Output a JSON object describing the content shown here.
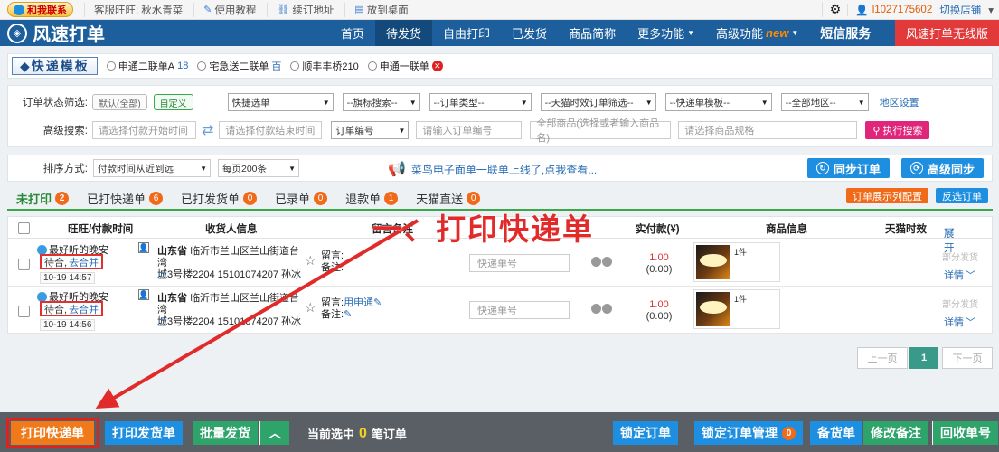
{
  "topbar": {
    "contact_label": "和我联系",
    "service_label": "客服旺旺:",
    "service_name": "秋水青菜",
    "tutorial": "使用教程",
    "renew": "续订地址",
    "desktop": "放到桌面",
    "username": "l1027175602",
    "switch_store": "切换店铺"
  },
  "nav": {
    "app_title": "风速打单",
    "items": [
      "首页",
      "待发货",
      "自由打印",
      "已发货",
      "商品简称",
      "更多功能",
      "高级功能"
    ],
    "new_tag": "new",
    "sms": "短信服务",
    "unlimited": "风速打单无线版"
  },
  "templates": {
    "label": "快递模板",
    "options": [
      {
        "name": "申通二联单A",
        "count": "18"
      },
      {
        "name": "宅急送二联单",
        "count": "百"
      },
      {
        "name": "顺丰丰桥210",
        "count": ""
      },
      {
        "name": "申通一联单",
        "count": ""
      }
    ]
  },
  "filter": {
    "status_label": "订单状态筛选:",
    "chip_default": "默认(全部)",
    "chip_custom": "自定义",
    "selects": [
      "快捷选单",
      "--旗标搜索--",
      "--订单类型--",
      "--天猫时效订单筛选--",
      "--快递单模板--",
      "--全部地区--"
    ],
    "region_settings": "地区设置",
    "advanced_label": "高级搜索:",
    "start_time_ph": "请选择付款开始时间",
    "end_time_ph": "请选择付款结束时间",
    "order_no_select": "订单编号",
    "order_no_ph": "请输入订单编号",
    "goods_ph": "全部商品(选择或者输入商品名)",
    "spec_ph": "请选择商品规格",
    "exec_search": "执行搜索"
  },
  "sort": {
    "label": "排序方式:",
    "order_select": "付款时间从近到远",
    "page_size": "每页200条",
    "promo": "菜鸟电子面单一联单上线了,点我查看...",
    "sync": "同步订单",
    "adv_sync": "高级同步"
  },
  "tabs": {
    "items": [
      {
        "label": "未打印",
        "count": "2"
      },
      {
        "label": "已打快递单",
        "count": "6"
      },
      {
        "label": "已打发货单",
        "count": "0"
      },
      {
        "label": "已录单",
        "count": "0"
      },
      {
        "label": "退款单",
        "count": "1"
      },
      {
        "label": "天猫直送",
        "count": "0"
      }
    ],
    "config_btn": "订单展示列配置",
    "invert_btn": "反选订单"
  },
  "table": {
    "headers": {
      "ww": "旺旺/付款时间",
      "receiver": "收货人信息",
      "memo": "留言备注",
      "amount": "实付款(¥)",
      "goods": "商品信息",
      "tmall": "天猫时效",
      "expand": "展开"
    },
    "rows": [
      {
        "ww": "最好听的晚安",
        "wait": "待合,",
        "merge": "去合并",
        "date": "10-19 14:57",
        "province": "山东省",
        "addr1": "临沂市兰山区兰山街道台湾",
        "addr2": "城3号楼2204 15101074207 孙冰",
        "memo_label": "留言:",
        "memo_val": "",
        "note_label": "备注:",
        "tracking_ph": "快递单号",
        "paid": "1.00",
        "sub": "(0.00)",
        "qty": "1件",
        "partial": "部分发货",
        "detail": "详情"
      },
      {
        "ww": "最好听的晚安",
        "wait": "待合,",
        "merge": "去合并",
        "date": "10-19 14:56",
        "province": "山东省",
        "addr1": "临沂市兰山区兰山街道台湾",
        "addr2": "城3号楼2204 15101074207 孙冰",
        "memo_label": "留言:",
        "memo_val": "用申通",
        "note_label": "备注:",
        "tracking_ph": "快递单号",
        "paid": "1.00",
        "sub": "(0.00)",
        "qty": "1件",
        "partial": "部分发货",
        "detail": "详情"
      }
    ]
  },
  "pager": {
    "prev": "上一页",
    "current": "1",
    "next": "下一页"
  },
  "annotation": "一、打印快递单",
  "bottom": {
    "print_express": "打印快递单",
    "print_invoice": "打印发货单",
    "batch_ship": "批量发货",
    "selected_prefix": "当前选中",
    "selected_count": "0",
    "selected_suffix": "笔订单",
    "lock_order": "锁定订单",
    "lock_manage": "锁定订单管理",
    "lock_count": "0",
    "stock": "备货单",
    "edit_note": "修改备注",
    "recycle": "回收单号"
  },
  "colors": {
    "nav_bg": "#1d5f9c",
    "accent_red": "#e12a2a",
    "accent_green": "#3aa84a",
    "btn_blue": "#1e8fe0"
  }
}
